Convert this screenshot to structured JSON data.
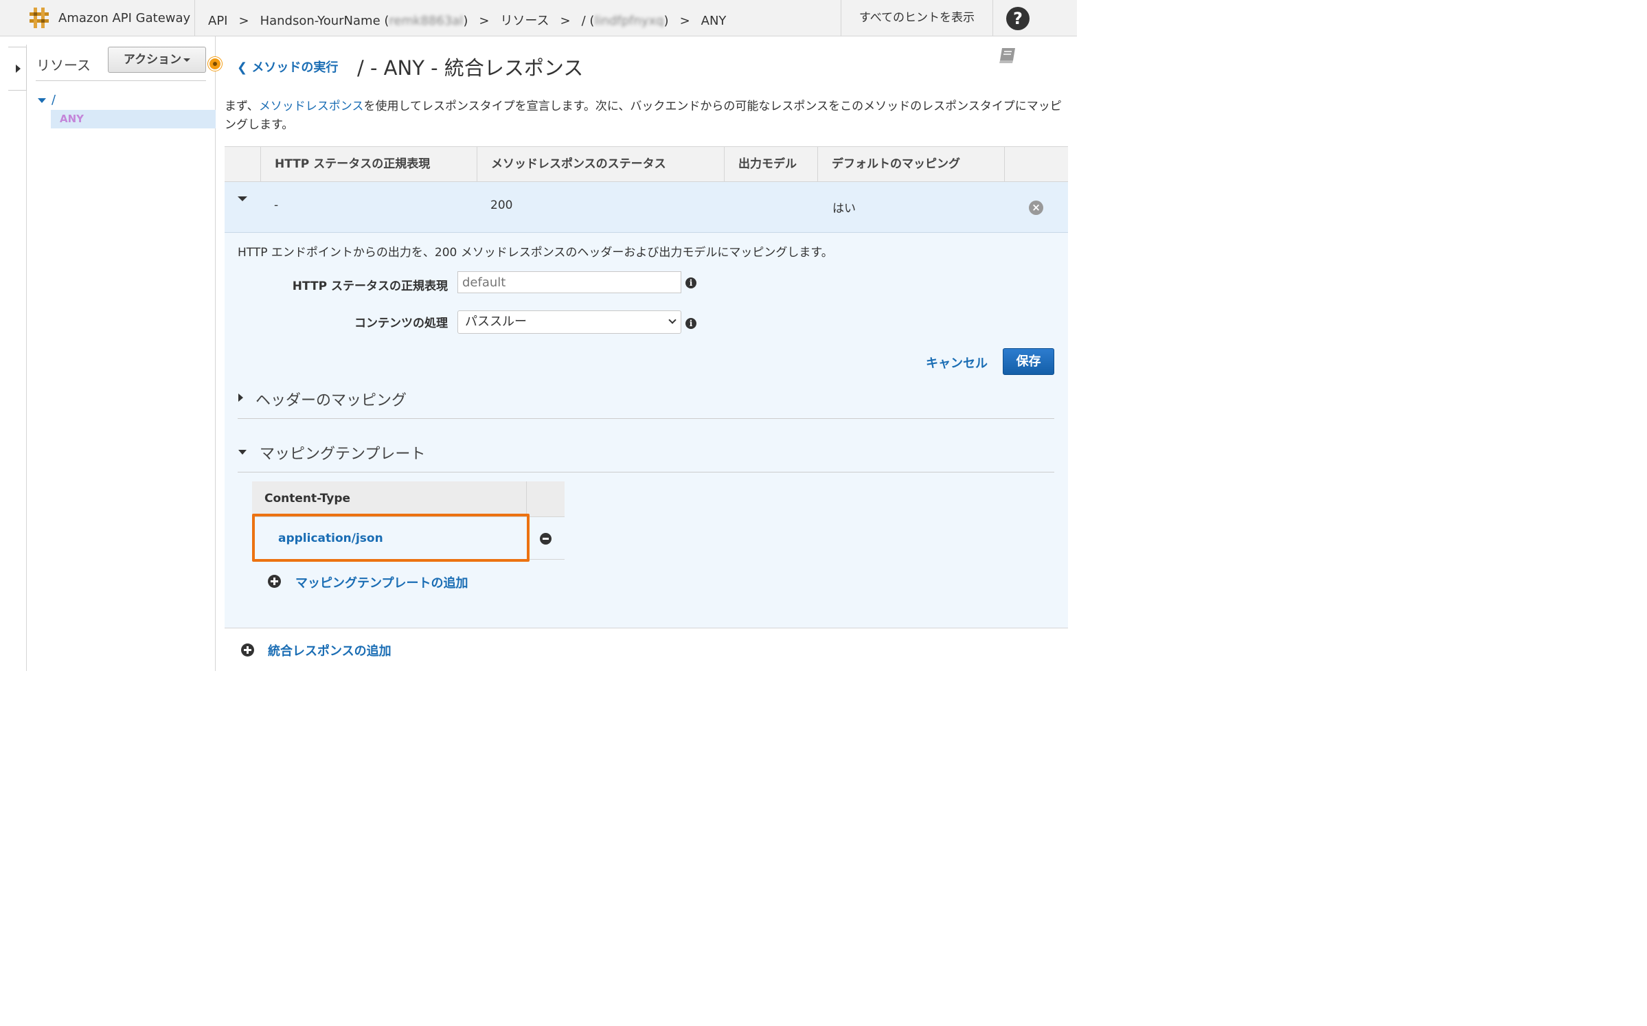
{
  "header": {
    "app_name": "Amazon API Gateway",
    "breadcrumbs": {
      "api": "API",
      "sep": ">",
      "api_name": "Handson-YourName (",
      "api_id": "remk8863al",
      "api_close": ")",
      "resources": "リソース",
      "resource_path": "/ (",
      "resource_id": "lindfpfnyxq",
      "resource_close": ")",
      "method": "ANY"
    },
    "hints_button": "すべてのヒントを表示",
    "help_icon": "?"
  },
  "resource_panel": {
    "title": "リソース",
    "actions_button": "アクション",
    "tree_root": "/",
    "tree_selected": "ANY"
  },
  "main": {
    "back_link": "メソッドの実行",
    "title": "/ - ANY - 統合レスポンス",
    "intro_before": "まず、",
    "intro_link": "メソッドレスポンス",
    "intro_after": "を使用してレスポンスタイプを宣言します。次に、バックエンドからの可能なレスポンスをこのメソッドのレスポンスタイプにマッピングします。"
  },
  "table": {
    "columns": [
      "HTTP ステータスの正規表現",
      "メソッドレスポンスのステータス",
      "出力モデル",
      "デフォルトのマッピング"
    ],
    "row": {
      "regex": "-",
      "status": "200",
      "model": "",
      "default": "はい"
    }
  },
  "detail": {
    "description": "HTTP エンドポイントからの出力を、200 メソッドレスポンスのヘッダーおよび出力モデルにマッピングします。",
    "regex_label": "HTTP ステータスの正規表現",
    "regex_placeholder": "default",
    "content_label": "コンテンツの処理",
    "content_value": "パススルー",
    "cancel": "キャンセル",
    "save": "保存",
    "header_mapping": "ヘッダーのマッピング",
    "mapping_templates": "マッピングテンプレート",
    "content_type_header": "Content-Type",
    "content_type_value": "application/json",
    "add_template": "マッピングテンプレートの追加"
  },
  "footer": {
    "add_integration_response": "統合レスポンスの追加"
  },
  "colors": {
    "link": "#1a6db4",
    "highlight": "#ec7211",
    "row_bg": "#e4f0fb",
    "save_button": "#1f6fc0"
  },
  "icons": [
    "api-gateway-logo-icon",
    "help-icon",
    "book-icon",
    "info-icon",
    "remove-icon",
    "minus-icon",
    "plus-icon",
    "back-arrow-icon"
  ]
}
